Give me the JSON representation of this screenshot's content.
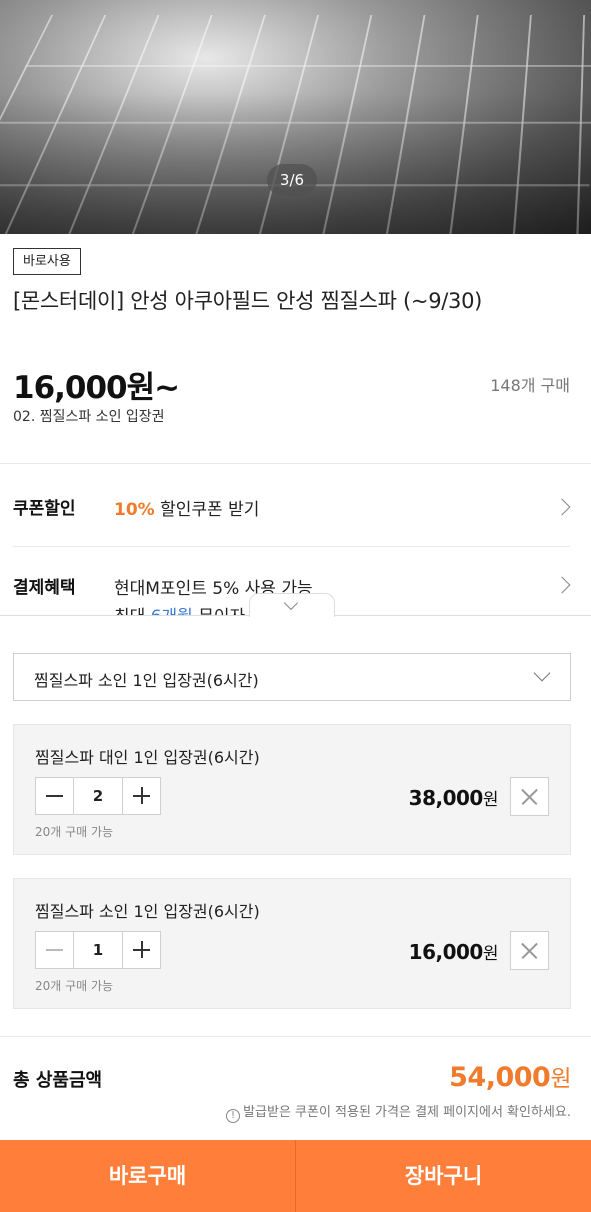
{
  "hero": {
    "image_counter": "3/6"
  },
  "product": {
    "badge": "바로사용",
    "title": "[몬스터데이] 안성 아쿠아필드 안성 찜질스파 (~9/30)",
    "price": "16,000원~",
    "option_name": "02. 찜질스파 소인 입장권",
    "purchase_count": "148개 구매"
  },
  "coupon": {
    "label": "쿠폰할인",
    "highlight": "10%",
    "text": " 할인쿠폰 받기"
  },
  "payment": {
    "label": "결제혜택",
    "text": "현대M포인트 5% 사용 가능",
    "more_prefix": "최대 ",
    "more_highlight": "6개월",
    "more_suffix": " 무이자"
  },
  "select": {
    "value": "찜질스파 소인 1인 입장권(6시간)"
  },
  "items": [
    {
      "name": "찜질스파 대인 1인 입장권(6시간)",
      "qty": "2",
      "price": "38,000",
      "won": "원",
      "available": "20개 구매 가능"
    },
    {
      "name": "찜질스파 소인 1인 입장권(6시간)",
      "qty": "1",
      "price": "16,000",
      "won": "원",
      "available": "20개 구매 가능"
    }
  ],
  "total": {
    "label": "총 상품금액",
    "price": "54,000",
    "won": "원",
    "notice": "발급받은 쿠폰이 적용된 가격은 결제 페이지에서 확인하세요."
  },
  "buttons": {
    "buy_now": "바로구매",
    "cart": "장바구니"
  },
  "colors": {
    "accent": "#ff7f3a",
    "price_accent": "#f07b2c",
    "link": "#3a7bd5"
  }
}
